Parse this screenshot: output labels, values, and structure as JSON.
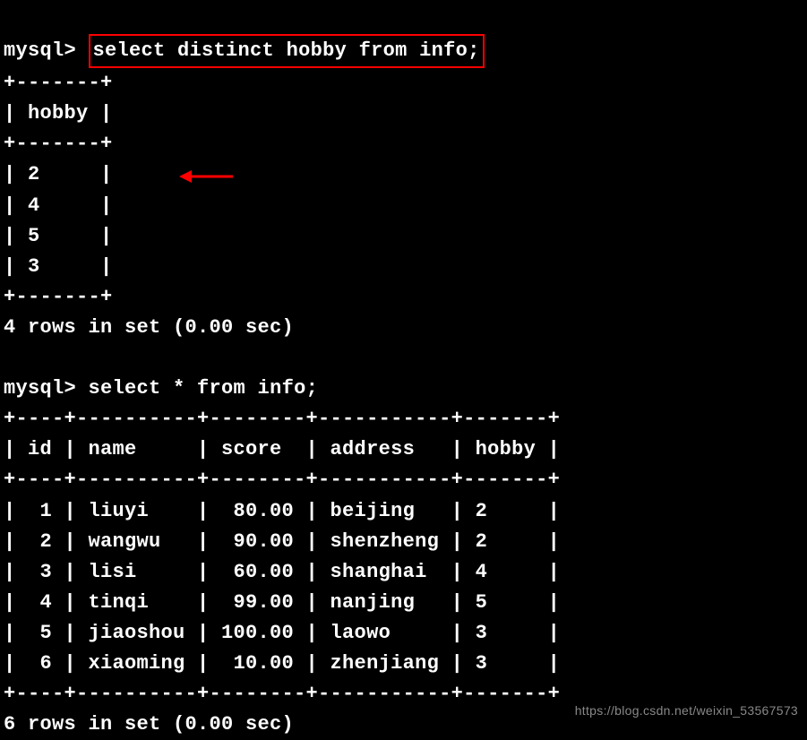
{
  "prompt": "mysql>",
  "query1": {
    "command": "select distinct hobby from info;",
    "table": {
      "border_top": "+-------+",
      "header_row": "| hobby |",
      "border_mid": "+-------+",
      "rows": [
        "| 2     |",
        "| 4     |",
        "| 5     |",
        "| 3     |"
      ],
      "border_bot": "+-------+"
    },
    "status": "4 rows in set (0.00 sec)"
  },
  "query2": {
    "command": "select * from info;",
    "table": {
      "border_top": "+----+----------+--------+-----------+-------+",
      "header_row": "| id | name     | score  | address   | hobby |",
      "border_mid": "+----+----------+--------+-----------+-------+",
      "rows": [
        "|  1 | liuyi    |  80.00 | beijing   | 2     |",
        "|  2 | wangwu   |  90.00 | shenzheng | 2     |",
        "|  3 | lisi     |  60.00 | shanghai  | 4     |",
        "|  4 | tinqi    |  99.00 | nanjing   | 5     |",
        "|  5 | jiaoshou | 100.00 | laowo     | 3     |",
        "|  6 | xiaoming |  10.00 | zhenjiang | 3     |"
      ],
      "border_bot": "+----+----------+--------+-----------+-------+"
    },
    "status": "6 rows in set (0.00 sec)"
  },
  "watermark": "https://blog.csdn.net/weixin_53567573",
  "chart_data": {
    "type": "table",
    "tables": [
      {
        "title": "select distinct hobby from info",
        "columns": [
          "hobby"
        ],
        "rows": [
          [
            "2"
          ],
          [
            "4"
          ],
          [
            "5"
          ],
          [
            "3"
          ]
        ]
      },
      {
        "title": "select * from info",
        "columns": [
          "id",
          "name",
          "score",
          "address",
          "hobby"
        ],
        "rows": [
          [
            1,
            "liuyi",
            80.0,
            "beijing",
            2
          ],
          [
            2,
            "wangwu",
            90.0,
            "shenzheng",
            2
          ],
          [
            3,
            "lisi",
            60.0,
            "shanghai",
            4
          ],
          [
            4,
            "tinqi",
            99.0,
            "nanjing",
            5
          ],
          [
            5,
            "jiaoshou",
            100.0,
            "laowo",
            3
          ],
          [
            6,
            "xiaoming",
            10.0,
            "zhenjiang",
            3
          ]
        ]
      }
    ]
  }
}
